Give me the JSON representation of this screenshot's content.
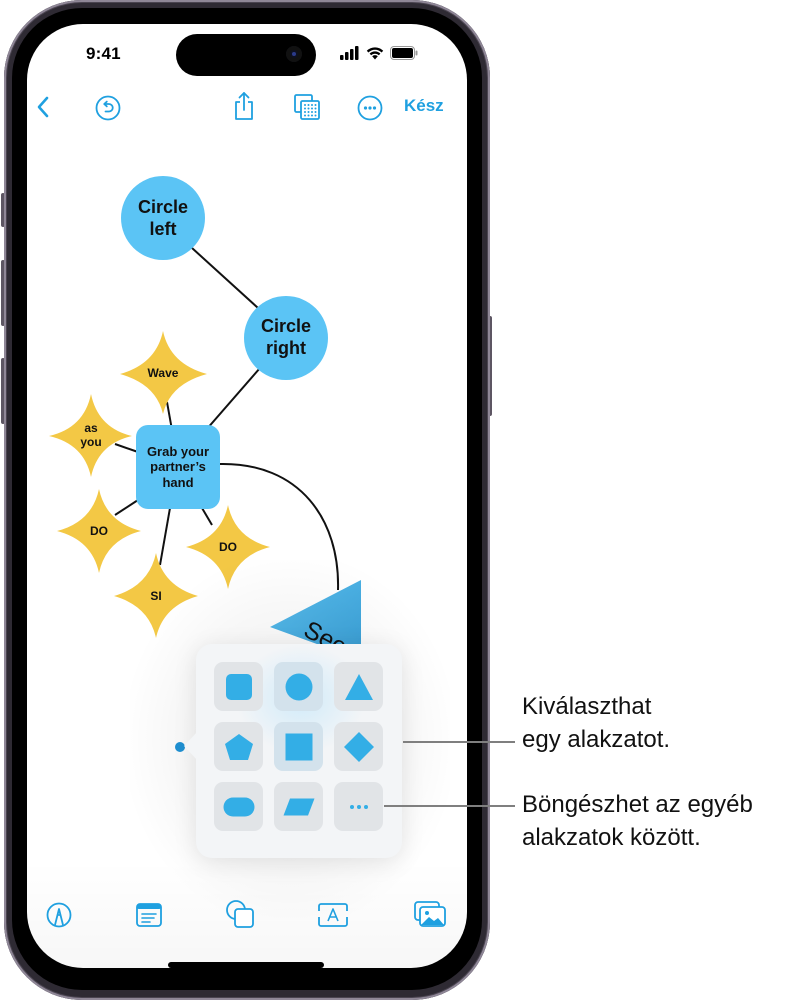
{
  "status_bar": {
    "time": "9:41",
    "icons": [
      "cellular-signal-icon",
      "wifi-icon",
      "battery-icon"
    ]
  },
  "top_toolbar": {
    "back_icon": "chevron-left-icon",
    "undo_icon": "undo-circle-icon",
    "share_icon": "share-icon",
    "view_icon": "grid-view-icon",
    "more_icon": "more-circle-icon",
    "done_label": "Kész"
  },
  "board": {
    "nodes": [
      {
        "id": "circle-left",
        "shape": "circle",
        "label_lines": [
          "Circle",
          "left"
        ],
        "color": "#5bc4f5"
      },
      {
        "id": "circle-right",
        "shape": "circle",
        "label_lines": [
          "Circle",
          "right"
        ],
        "color": "#5bc4f5"
      },
      {
        "id": "wave",
        "shape": "star",
        "label": "Wave",
        "color": "#f3c845"
      },
      {
        "id": "as-you",
        "shape": "star",
        "label_lines": [
          "as",
          "you"
        ],
        "color": "#f3c845"
      },
      {
        "id": "grab-hand",
        "shape": "rounded-square",
        "label_lines": [
          "Grab your",
          "partner’s",
          "hand"
        ],
        "color": "#5bc4f5"
      },
      {
        "id": "do-left",
        "shape": "star",
        "label": "DO",
        "color": "#f3c845"
      },
      {
        "id": "do-right",
        "shape": "star",
        "label": "DO",
        "color": "#f3c845"
      },
      {
        "id": "si",
        "shape": "star",
        "label": "SI",
        "color": "#f3c845"
      },
      {
        "id": "see-triangle",
        "shape": "triangle",
        "label": "See",
        "color": "#4fb3e6"
      }
    ],
    "connections": [
      [
        "circle-left",
        "circle-right"
      ],
      [
        "circle-right",
        "grab-hand"
      ],
      [
        "wave",
        "grab-hand"
      ],
      [
        "as-you",
        "grab-hand"
      ],
      [
        "do-left",
        "grab-hand"
      ],
      [
        "si",
        "grab-hand"
      ],
      [
        "do-right",
        "grab-hand"
      ],
      [
        "grab-hand",
        "see-triangle"
      ]
    ]
  },
  "shape_picker": {
    "accent": "#33aee6",
    "shapes": [
      {
        "name": "rounded-square",
        "highlighted": false
      },
      {
        "name": "circle",
        "highlighted": true
      },
      {
        "name": "triangle",
        "highlighted": false
      },
      {
        "name": "pentagon",
        "highlighted": false
      },
      {
        "name": "square",
        "highlighted": true
      },
      {
        "name": "diamond",
        "highlighted": false
      },
      {
        "name": "pill",
        "highlighted": false
      },
      {
        "name": "parallelogram",
        "highlighted": false
      },
      {
        "name": "more-shapes",
        "highlighted": false
      }
    ]
  },
  "callouts": {
    "select_shape": [
      "Kiválaszthat",
      "egy alakzatot."
    ],
    "browse_shapes": [
      "Böngészhet az egyéb",
      "alakzatok között."
    ]
  },
  "bottom_toolbar": {
    "items": [
      {
        "name": "pen-tool-icon"
      },
      {
        "name": "sticky-note-icon"
      },
      {
        "name": "shapes-icon"
      },
      {
        "name": "text-box-icon"
      },
      {
        "name": "media-icon"
      }
    ]
  },
  "colors": {
    "accent_blue": "#1fa0e0",
    "node_blue": "#5bc4f5",
    "node_yellow": "#f3c845"
  }
}
